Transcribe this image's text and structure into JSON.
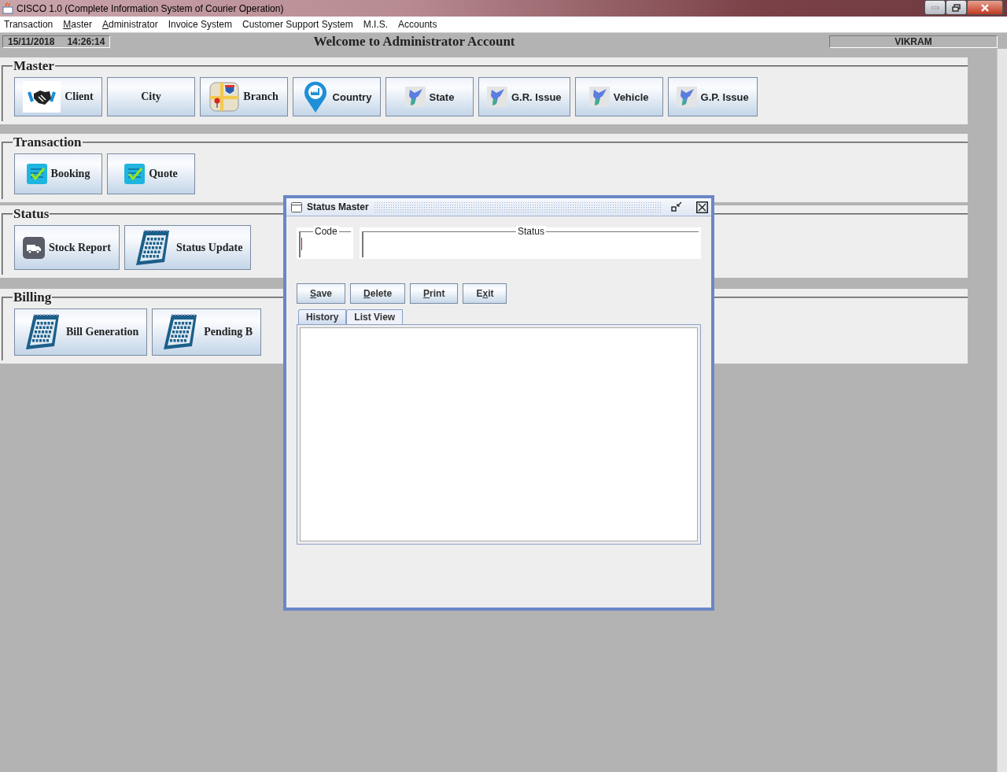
{
  "window": {
    "title": "CISCO 1.0 (Complete Information System of Courier Operation)"
  },
  "menu": [
    {
      "label": "Transaction"
    },
    {
      "key": "M",
      "after": "aster"
    },
    {
      "key": "A",
      "after": "dministrator"
    },
    {
      "label": "Invoice System"
    },
    {
      "label": "Customer Support System"
    },
    {
      "label": "M.I.S."
    },
    {
      "label": "Accounts"
    }
  ],
  "status_bar": {
    "date": "15/11/2018",
    "time": "14:26:14",
    "welcome": "Welcome to Administrator Account",
    "user": "VIKRAM"
  },
  "sections": [
    {
      "title": "Master",
      "buttons": [
        {
          "label": "Client",
          "kind": "handshake"
        },
        {
          "label": "City",
          "kind": "plain"
        },
        {
          "label": "Branch",
          "kind": "map"
        },
        {
          "label": "Country",
          "kind": "pin"
        },
        {
          "label": "State",
          "kind": "region"
        },
        {
          "label": "G.R. Issue",
          "kind": "region"
        },
        {
          "label": "Vehicle",
          "kind": "region"
        },
        {
          "label": "G.P. Issue",
          "kind": "region"
        }
      ]
    },
    {
      "title": "Transaction",
      "buttons": [
        {
          "label": "Booking",
          "kind": "checklist"
        },
        {
          "label": "Quote",
          "kind": "checklist"
        }
      ]
    },
    {
      "title": "Status",
      "buttons": [
        {
          "label": "Stock Report",
          "kind": "truck"
        },
        {
          "label": "Status Update",
          "kind": "calendar"
        }
      ]
    },
    {
      "title": "Billing",
      "buttons": [
        {
          "label": "Bill Generation",
          "kind": "calendar"
        },
        {
          "label": "Pending B",
          "kind": "calendar"
        }
      ]
    }
  ],
  "dialog": {
    "title": "Status Master",
    "fields": [
      {
        "label": "Code",
        "focused": true
      },
      {
        "label": "Status",
        "focused": false
      }
    ],
    "buttons": [
      {
        "key": "S",
        "after": "ave"
      },
      {
        "key": "D",
        "after": "elete"
      },
      {
        "key": "P",
        "after": "rint"
      },
      {
        "before": "E",
        "key": "x",
        "after": "it"
      }
    ],
    "tabs": [
      {
        "label": "History",
        "selected": true
      },
      {
        "label": "List View",
        "selected": false
      }
    ]
  }
}
